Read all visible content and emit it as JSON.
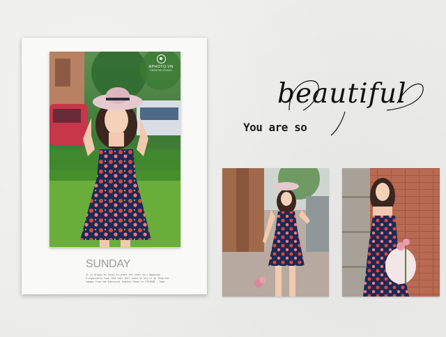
{
  "watermark": {
    "logo_icon": "aperture-icon",
    "name": "APHOTO.VN",
    "sub": "CREATIVE STUDIO"
  },
  "card": {
    "title": "SUNDAY",
    "caption_lines": [
      "It is always an honor to grace the cover of a magazine -",
      "I especially love that this 2017 cover is one of my favorite",
      "images from the Editorial Fashion Shoot at FIFIEEN - Team"
    ]
  },
  "heading": {
    "lead": "You are so",
    "script": "beautiful"
  },
  "colors": {
    "background": "#ececea",
    "card": "#f9f9f8",
    "title_gray": "#9a9a9a",
    "dress_navy": "#1c2a55",
    "flower_red": "#e0453e",
    "grass": "#4f9a2e",
    "hat": "#e6c9cf"
  }
}
